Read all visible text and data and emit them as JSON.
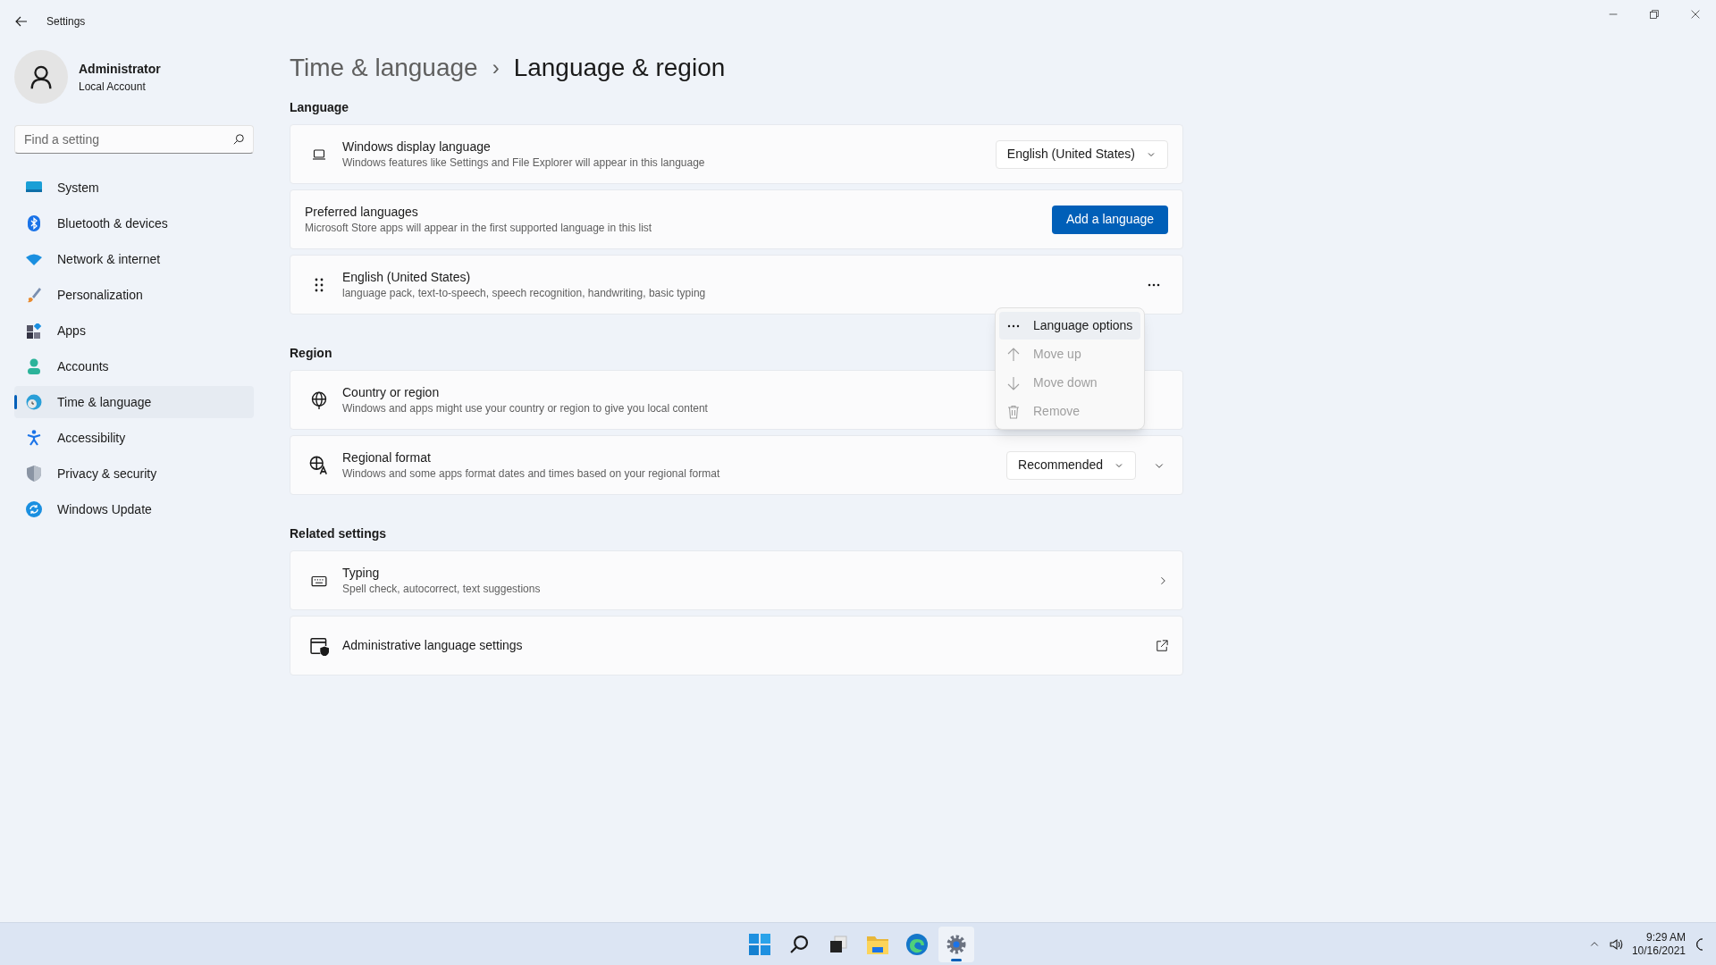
{
  "window": {
    "title": "Settings"
  },
  "account": {
    "name": "Administrator",
    "type": "Local Account"
  },
  "search": {
    "placeholder": "Find a setting"
  },
  "sidebar": {
    "items": [
      {
        "label": "System",
        "selected": false
      },
      {
        "label": "Bluetooth & devices",
        "selected": false
      },
      {
        "label": "Network & internet",
        "selected": false
      },
      {
        "label": "Personalization",
        "selected": false
      },
      {
        "label": "Apps",
        "selected": false
      },
      {
        "label": "Accounts",
        "selected": false
      },
      {
        "label": "Time & language",
        "selected": true
      },
      {
        "label": "Accessibility",
        "selected": false
      },
      {
        "label": "Privacy & security",
        "selected": false
      },
      {
        "label": "Windows Update",
        "selected": false
      }
    ]
  },
  "breadcrumb": {
    "parent": "Time & language",
    "separator": "›",
    "current": "Language & region"
  },
  "sections": [
    {
      "heading": "Language",
      "cards": [
        {
          "kind": "dropdown",
          "title": "Windows display language",
          "subtitle": "Windows features like Settings and File Explorer will appear in this language",
          "value": "English (United States)"
        },
        {
          "kind": "button",
          "title": "Preferred languages",
          "subtitle": "Microsoft Store apps will appear in the first supported language in this list",
          "button": "Add a language"
        },
        {
          "kind": "language",
          "title": "English (United States)",
          "subtitle": "language pack, text-to-speech, speech recognition, handwriting, basic typing"
        }
      ]
    },
    {
      "heading": "Region",
      "cards": [
        {
          "kind": "plain",
          "title": "Country or region",
          "subtitle": "Windows and apps might use your country or region to give you local content"
        },
        {
          "kind": "expander",
          "title": "Regional format",
          "subtitle": "Windows and some apps format dates and times based on your regional format",
          "value": "Recommended",
          "expanded": false
        }
      ]
    },
    {
      "heading": "Related settings",
      "cards": [
        {
          "kind": "link",
          "title": "Typing",
          "subtitle": "Spell check, autocorrect, text suggestions"
        },
        {
          "kind": "external",
          "title": "Administrative language settings"
        }
      ]
    }
  ],
  "context_menu": {
    "items": [
      {
        "label": "Language options",
        "selected": true,
        "disabled": false
      },
      {
        "label": "Move up",
        "selected": false,
        "disabled": true
      },
      {
        "label": "Move down",
        "selected": false,
        "disabled": true
      },
      {
        "label": "Remove",
        "selected": false,
        "disabled": true
      }
    ]
  },
  "taskbar": {
    "apps": [
      {
        "selected": false
      },
      {
        "selected": false
      },
      {
        "selected": false
      },
      {
        "selected": false
      },
      {
        "selected": false
      },
      {
        "selected": true
      }
    ],
    "time": "9:29 AM",
    "date": "10/16/2021"
  }
}
